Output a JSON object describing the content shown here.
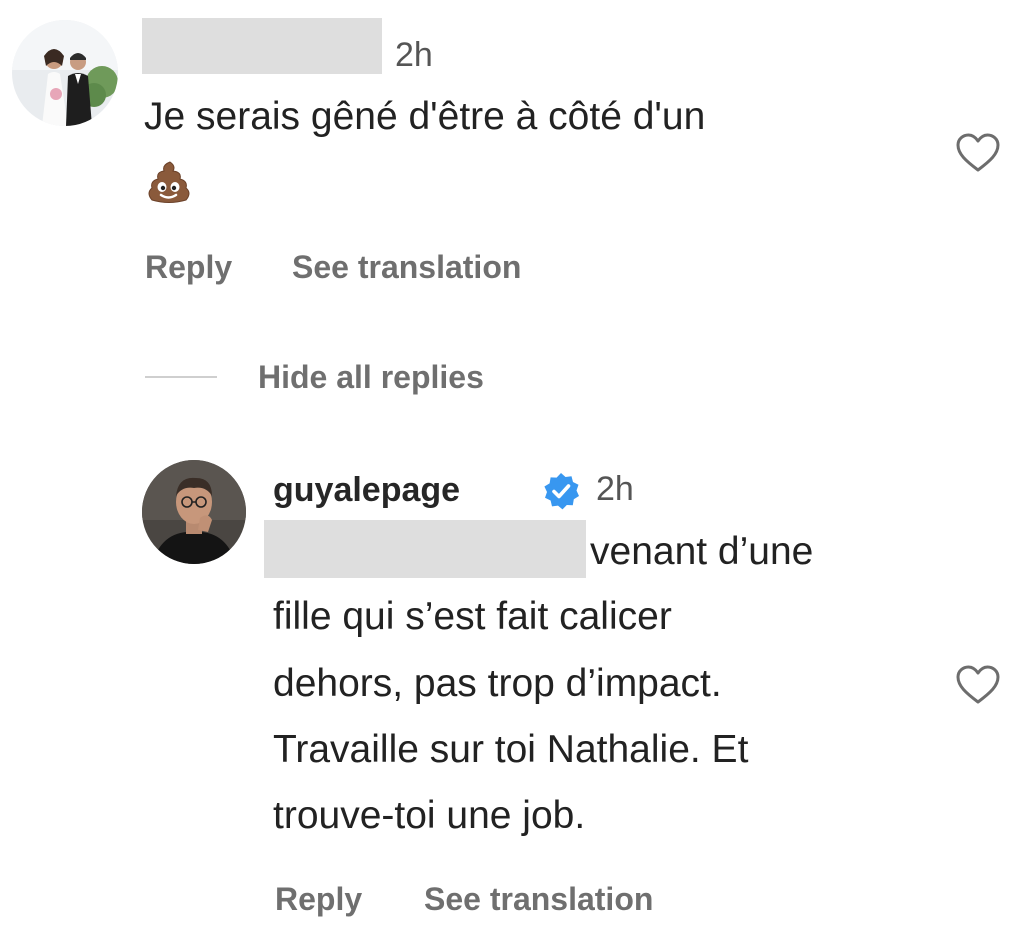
{
  "comment1": {
    "time": "2h",
    "text_line1": "Je serais gêné d'être à côté d'un",
    "reply_label": "Reply",
    "translation_label": "See translation"
  },
  "replies_toggle": {
    "label": "Hide all replies"
  },
  "comment2": {
    "username": "guyalepage",
    "time": "2h",
    "lines": [
      "venant d’une",
      "fille qui s’est fait calicer",
      "dehors, pas trop d’impact.",
      "Travaille sur toi Nathalie. Et",
      "trouve-toi une job."
    ],
    "reply_label": "Reply",
    "translation_label": "See translation"
  },
  "colors": {
    "verified_blue": "#3897f0",
    "action_gray": "#6f6f6f",
    "redaction_gray": "#dedede"
  },
  "icons": {
    "like": "heart-outline-icon",
    "verified": "verified-badge-icon",
    "emoji": "pile-of-poo-emoji"
  }
}
